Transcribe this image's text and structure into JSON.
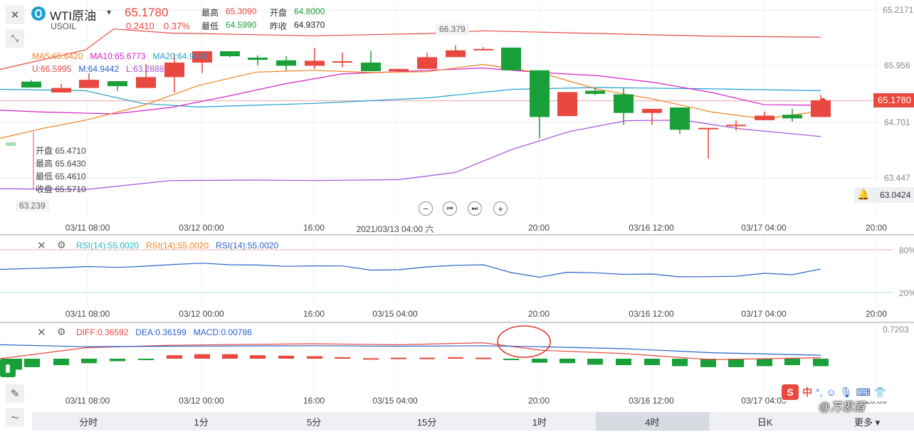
{
  "header": {
    "symbol": "WTI原油",
    "code": "USOIL",
    "price": "65.1780",
    "change": "0.2410",
    "change_pct": "0.37%",
    "high_label": "最高",
    "high": "65.3090",
    "open_label": "开盘",
    "open": "64.8000",
    "low_label": "最低",
    "low": "64.5990",
    "prev_label": "昨收",
    "prev": "64.9370"
  },
  "ma": {
    "ma5": "MA5:65.6420",
    "ma10": "MA10:65.6773",
    "ma20": "MA20:64.9442",
    "u": "U:66.5995",
    "m": "M:64.9442",
    "l": "L:63.2888",
    "colors": {
      "ma5": "#f0821e",
      "ma10": "#d322c8",
      "ma20": "#1e9fd0",
      "u": "#e8483f",
      "m": "#2b63c9",
      "l": "#a34fd8"
    }
  },
  "ohlc_tooltip": {
    "open": "开盘 65.4710",
    "high": "最高 65.6430",
    "low": "最低 65.4610",
    "close": "收盘 65.5710"
  },
  "price_axis": {
    "top": "65.2171",
    "t1": "65.956",
    "t2": "64.701",
    "t3": "63.447",
    "current": "65.1780",
    "alert": "63.0424",
    "max_label": "66.379",
    "min_label": "63.239"
  },
  "main_xaxis": [
    "03/11 08:00",
    "03/12 00:00",
    "16:00",
    "2021/03/13 04:00 六",
    "20:00",
    "03/16 12:00",
    "03/17 04:00",
    "20:00"
  ],
  "nav_buttons": {
    "zoom_out": "−",
    "first": "⏮",
    "last": "⏭",
    "zoom_in": "+"
  },
  "rsi": {
    "l1": "RSI(14):55.0020",
    "l2": "RSI(14):55.0020",
    "l3": "RSI(14):55.0020",
    "hi": "80%",
    "lo": "20%",
    "colors": {
      "l1": "#21b8c8",
      "l2": "#f0821e",
      "l3": "#2b63c9"
    }
  },
  "sub_xaxis": [
    "03/11 08:00",
    "03/12 00:00",
    "16:00",
    "03/15 04:00",
    "20:00",
    "03/16 12:00",
    "03/17 04:00",
    "20:00"
  ],
  "macd": {
    "diff": "DIFF:0.36592",
    "dea": "DEA:0.36199",
    "macd": "MACD:0.00786",
    "axis_top": "0.7203",
    "colors": {
      "diff": "#e8483f",
      "dea": "#2b63c9",
      "macd": "#2b63c9"
    }
  },
  "tabs": [
    "分时",
    "1分",
    "5分",
    "15分",
    "1时",
    "4时",
    "日K"
  ],
  "active_tab": "4时",
  "more": "更多",
  "watermark": "@万思酒",
  "ime": {
    "lang": "中",
    "punct": "°,"
  },
  "colors": {
    "up": "#e8483f",
    "down": "#1aa038"
  }
}
